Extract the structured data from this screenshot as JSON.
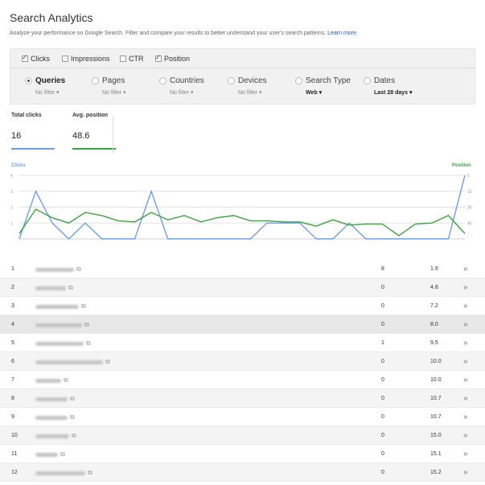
{
  "header": {
    "title": "Search Analytics",
    "subtitle": "Analyze your performance on Google Search. Filter and compare your results to better understand your user's search patterns.",
    "learn_more": "Learn more."
  },
  "metrics": [
    {
      "label": "Clicks",
      "checked": true
    },
    {
      "label": "Impressions",
      "checked": false
    },
    {
      "label": "CTR",
      "checked": false
    },
    {
      "label": "Position",
      "checked": true
    }
  ],
  "dimensions": [
    {
      "label": "Queries",
      "sub": "No filter ▾",
      "selected": true
    },
    {
      "label": "Pages",
      "sub": "No filter ▾",
      "selected": false
    },
    {
      "label": "Countries",
      "sub": "No filter ▾",
      "selected": false
    },
    {
      "label": "Devices",
      "sub": "No filter ▾",
      "selected": false
    },
    {
      "label": "Search Type",
      "sub": "Web ▾",
      "selected": false
    },
    {
      "label": "Dates",
      "sub": "Last 28 days ▾",
      "selected": false
    }
  ],
  "totals": {
    "clicks_label": "Total clicks",
    "clicks_value": "16",
    "position_label": "Avg. position",
    "position_value": "48.6"
  },
  "colors": {
    "clicks": "#6d9eeb",
    "position": "#3aa53a",
    "link": "#1a55c7"
  },
  "chart_data": {
    "type": "line",
    "left_axis_label": "Clicks",
    "right_axis_label": "Position",
    "left_ticks": [
      "4",
      "3",
      "2",
      "1"
    ],
    "right_ticks": [
      "0",
      "15",
      "30",
      "45"
    ],
    "left_ylim": [
      0,
      4
    ],
    "right_ylim": [
      0,
      60
    ],
    "series": [
      {
        "name": "Clicks",
        "axis": "left",
        "values": [
          0,
          3,
          1,
          0,
          1,
          0,
          0,
          0,
          3,
          0,
          0,
          0,
          0,
          0,
          0,
          1,
          1,
          1,
          0,
          0,
          1,
          0,
          0,
          0,
          0,
          0,
          0,
          4
        ]
      },
      {
        "name": "Position",
        "axis": "right",
        "values": [
          55,
          32,
          40,
          45,
          35,
          38,
          43,
          44,
          35,
          42,
          38,
          44,
          40,
          38,
          43,
          43,
          44,
          44,
          48,
          42,
          47,
          46,
          46,
          57,
          46,
          45,
          38,
          55
        ]
      }
    ]
  },
  "rows": [
    {
      "index": "1",
      "clicks": "8",
      "position": "1.9",
      "blur": 48
    },
    {
      "index": "2",
      "clicks": "0",
      "position": "4.8",
      "blur": 38
    },
    {
      "index": "3",
      "clicks": "0",
      "position": "7.2",
      "blur": 54
    },
    {
      "index": "4",
      "clicks": "0",
      "position": "8.0",
      "blur": 58
    },
    {
      "index": "5",
      "clicks": "1",
      "position": "9.5",
      "blur": 60
    },
    {
      "index": "6",
      "clicks": "0",
      "position": "10.0",
      "blur": 84
    },
    {
      "index": "7",
      "clicks": "0",
      "position": "10.0",
      "blur": 32
    },
    {
      "index": "8",
      "clicks": "0",
      "position": "10.7",
      "blur": 40
    },
    {
      "index": "9",
      "clicks": "0",
      "position": "10.7",
      "blur": 40
    },
    {
      "index": "10",
      "clicks": "0",
      "position": "15.0",
      "blur": 42
    },
    {
      "index": "11",
      "clicks": "0",
      "position": "15.1",
      "blur": 28
    },
    {
      "index": "12",
      "clicks": "0",
      "position": "15.2",
      "blur": 62
    }
  ],
  "icons": {
    "external": "external-link-icon",
    "more": "double-chevron-icon"
  },
  "glyphs": {
    "external": "⧉",
    "more": "»"
  }
}
